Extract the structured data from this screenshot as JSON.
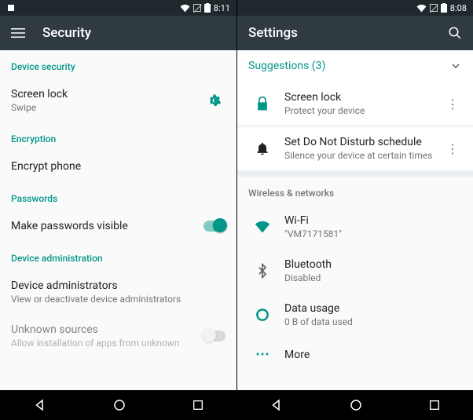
{
  "left": {
    "status_time": "8:11",
    "appbar_title": "Security",
    "section_device_security": "Device security",
    "screen_lock_title": "Screen lock",
    "screen_lock_sub": "Swipe",
    "section_encryption": "Encryption",
    "encrypt_phone": "Encrypt phone",
    "section_passwords": "Passwords",
    "make_passwords_visible": "Make passwords visible",
    "section_device_admin": "Device administration",
    "device_admins_title": "Device administrators",
    "device_admins_sub": "View or deactivate device administrators",
    "unknown_sources_title": "Unknown sources",
    "unknown_sources_sub": "Allow installation of apps from unknown"
  },
  "right": {
    "status_time": "8:08",
    "appbar_title": "Settings",
    "suggestions_label": "Suggestions (3)",
    "suggest1_title": "Screen lock",
    "suggest1_sub": "Protect your device",
    "suggest2_title": "Set Do Not Disturb schedule",
    "suggest2_sub": "Silence your device at certain times",
    "section_wireless": "Wireless & networks",
    "wifi_title": "Wi-Fi",
    "wifi_sub": "\"VM7171581\"",
    "bluetooth_title": "Bluetooth",
    "bluetooth_sub": "Disabled",
    "data_title": "Data usage",
    "data_sub": "0 B of data used",
    "more_title": "More"
  }
}
